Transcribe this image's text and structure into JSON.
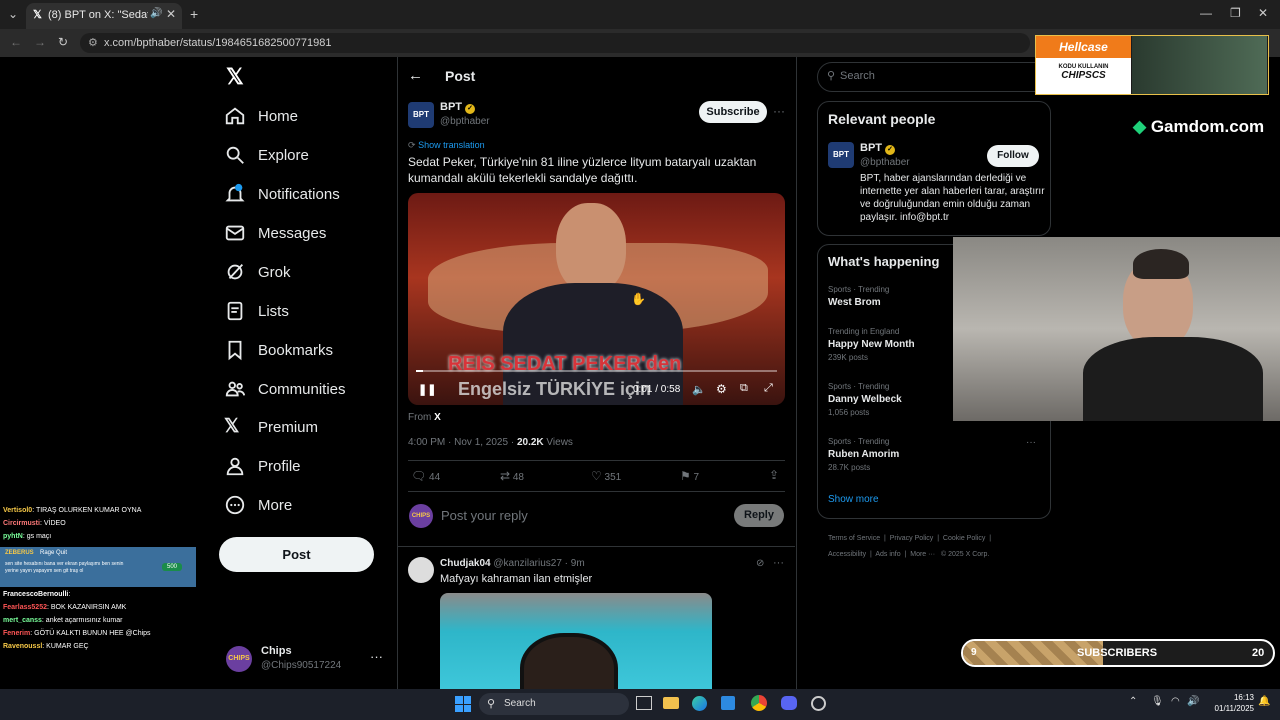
{
  "browser": {
    "tab_title": "(8) BPT on X: \"Sedat Peker, ...",
    "url": "x.com/bpthaber/status/1984651682500771981"
  },
  "sidebar": {
    "items": [
      {
        "label": "Home",
        "icon": "home-icon"
      },
      {
        "label": "Explore",
        "icon": "search-icon"
      },
      {
        "label": "Notifications",
        "icon": "bell-icon",
        "badge": "8"
      },
      {
        "label": "Messages",
        "icon": "mail-icon"
      },
      {
        "label": "Grok",
        "icon": "grok-icon"
      },
      {
        "label": "Lists",
        "icon": "list-icon"
      },
      {
        "label": "Bookmarks",
        "icon": "bookmark-icon"
      },
      {
        "label": "Communities",
        "icon": "people-icon"
      },
      {
        "label": "Premium",
        "icon": "x-logo-icon"
      },
      {
        "label": "Profile",
        "icon": "person-icon"
      },
      {
        "label": "More",
        "icon": "more-circle-icon"
      }
    ],
    "post_label": "Post",
    "account": {
      "name": "Chips",
      "handle": "@Chips90517224"
    }
  },
  "post": {
    "header_title": "Post",
    "author_name": "BPT",
    "author_handle": "@bpthaber",
    "subscribe_label": "Subscribe",
    "show_translation": "Show translation",
    "text": "Sedat Peker, Türkiye'nin 81 iline yüzlerce lityum bataryalı uzaktan kumandalı akülü tekerlekli sandalye dağıttı.",
    "video_caption_1": "REIS SEDAT PEKER'den",
    "video_caption_2": "Engelsiz TÜRKİYE için",
    "video_time": "0:01 / 0:58",
    "video_progress": 0.02,
    "from_label": "From",
    "from_source": "X",
    "timestamp": "4:00 PM · Nov 1, 2025 · ",
    "views_count": "20.2K",
    "views_label": " Views",
    "stats": {
      "replies": "44",
      "reposts": "48",
      "likes": "351",
      "bookmarks": "7"
    },
    "reply_placeholder": "Post your reply",
    "reply_button": "Reply"
  },
  "reply": {
    "name": "Chudjak04",
    "handle": "@kanzilarius27 · 9m",
    "text": "Mafyayı kahraman ilan etmişler"
  },
  "right": {
    "search_placeholder": "Search",
    "relevant_title": "Relevant people",
    "person_name": "BPT",
    "person_handle": "@bpthaber",
    "follow_label": "Follow",
    "person_bio": "BPT, haber ajanslarından derlediği ve internette yer alan haberleri tarar, araştırır ve doğruluğundan emin olduğu zaman paylaşır. info@bpt.tr",
    "happening_title": "What's happening",
    "trends": [
      {
        "context": "Sports · Trending",
        "name": "West Brom",
        "count": ""
      },
      {
        "context": "Trending in England",
        "name": "Happy New Month",
        "count": "239K posts"
      },
      {
        "context": "Sports · Trending",
        "name": "Danny Welbeck",
        "count": "1,056 posts"
      },
      {
        "context": "Sports · Trending",
        "name": "Ruben Amorim",
        "count": "28.7K posts"
      }
    ],
    "show_more": "Show more",
    "footer": [
      "Terms of Service",
      "Privacy Policy",
      "Cookie Policy",
      "Accessibility",
      "Ads info",
      "More ···",
      "© 2025 X Corp."
    ]
  },
  "overlay": {
    "hellcase_brand": "Hellcase",
    "hellcase_text1": "KODU KULLANIN",
    "hellcase_code": "CHIPSCS",
    "gamdom": "Gamdom.com",
    "subs_left": "9",
    "subs_label": "SUBSCRIBERS",
    "subs_right": "20",
    "subs_progress": 0.45,
    "donation": {
      "title": "ZEBERUS",
      "subtitle": "Rage Quit",
      "amount": "500",
      "text": "sen site hesabını bana ver ekran paylaşımı ben senin yerine yayın yapayım sen git traş ol"
    },
    "chat": [
      {
        "user": "Vertisol0",
        "msg": ": TIRAŞ OLURKEN KUMAR OYNA"
      },
      {
        "user": "Circirmusti",
        "msg": ": VİDEO"
      },
      {
        "user": "pyhtN",
        "msg": ": gs maçı"
      },
      {
        "user": "FrancescoBernoulli",
        "msg": ":"
      },
      {
        "user": "Fearlass5252",
        "msg": ": BOK KAZANIRSIN AMK"
      },
      {
        "user": "mert_canss",
        "msg": ": anket açarmısınız kumar"
      },
      {
        "user": "Fenerim",
        "msg": ": GÖTÜ KALKTI BUNUN HEE @Chips"
      },
      {
        "user": "Ravenoussl",
        "msg": ": KUMAR GEÇ"
      }
    ]
  },
  "taskbar": {
    "search_label": "Search",
    "time": "16:13",
    "date": "01/11/2025"
  },
  "colors": {
    "accent": "#1d9bf0",
    "verified": "#e2b719"
  }
}
